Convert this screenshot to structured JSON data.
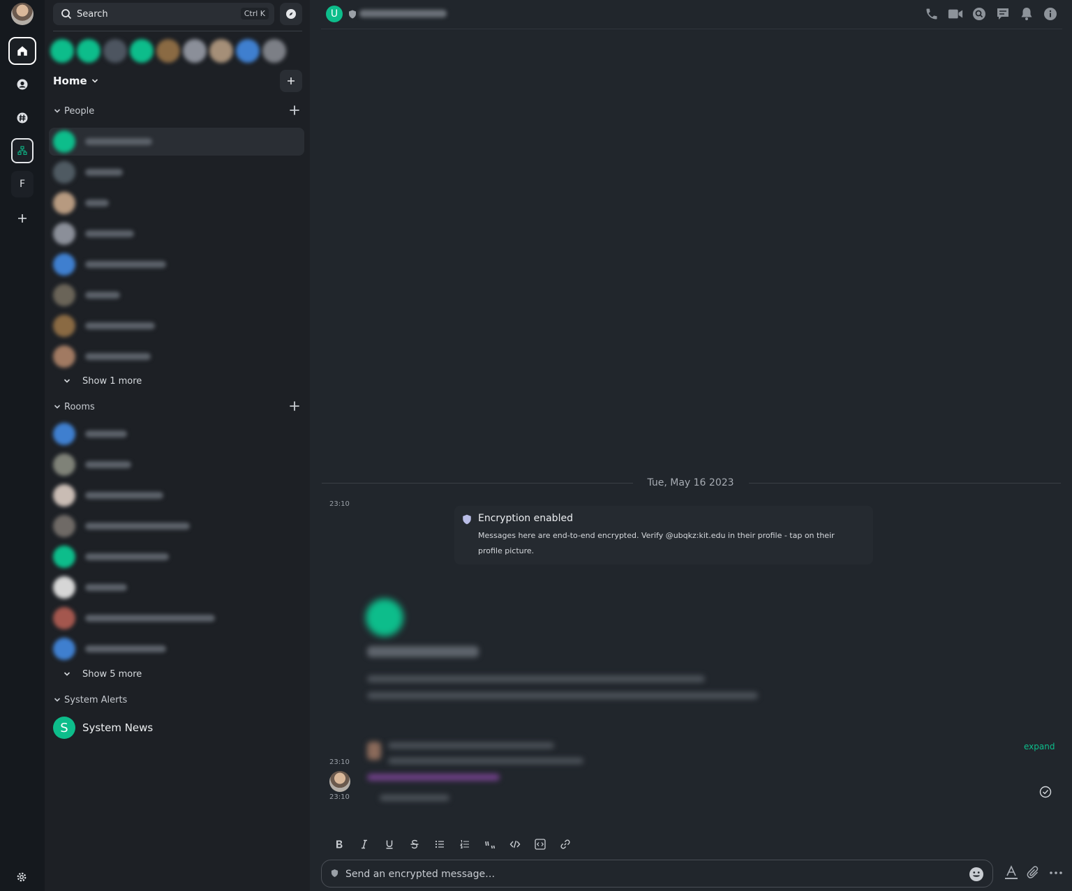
{
  "search": {
    "label": "Search",
    "shortcut": "Ctrl K"
  },
  "spaces": {
    "letter_space": "F"
  },
  "home": {
    "title": "Home"
  },
  "sections": {
    "people": {
      "label": "People",
      "show_more": "Show 1 more"
    },
    "rooms": {
      "label": "Rooms",
      "show_more": "Show 5 more"
    },
    "system_alerts": {
      "label": "System Alerts"
    }
  },
  "system_news": {
    "avatar_letter": "S",
    "name": "System News"
  },
  "room_header": {
    "avatar_letter": "U"
  },
  "timeline": {
    "date_separator": "Tue, May 16 2023",
    "encryption_event": {
      "timestamp": "23:10",
      "title": "Encryption enabled",
      "body": "Messages here are end-to-end encrypted. Verify @ubqkz:kit.edu in their profile - tap on their profile picture."
    },
    "message_timestamp_1": "23:10",
    "message_timestamp_2": "23:10",
    "expand_label": "expand"
  },
  "composer": {
    "placeholder": "Send an encrypted message…"
  },
  "colors": {
    "accent": "#0dbd8b",
    "background": "#21262c",
    "sidebar": "#1d2025",
    "spacebar": "#15191e"
  }
}
